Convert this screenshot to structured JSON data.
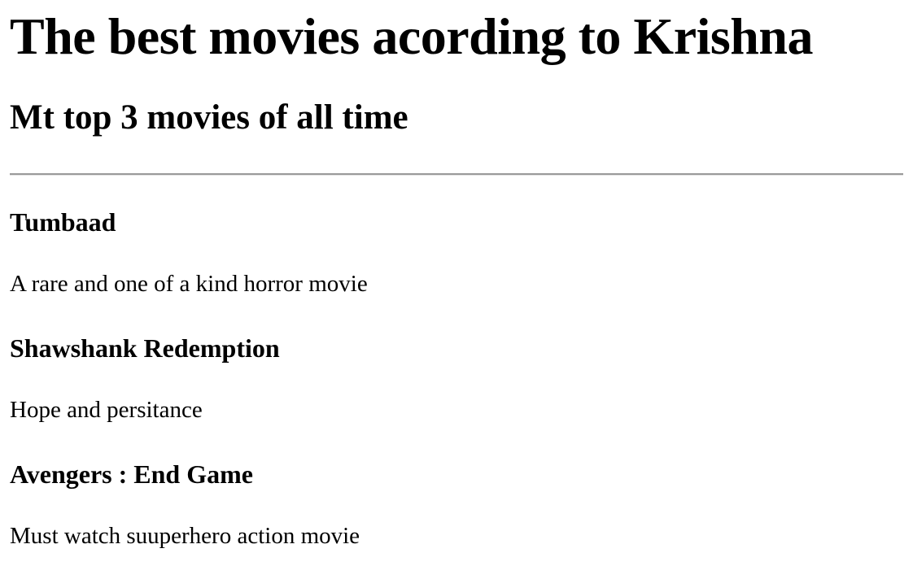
{
  "page": {
    "title": "The best movies acording to Krishna",
    "subtitle": "Mt top 3 movies of all time"
  },
  "movies": [
    {
      "title": "Tumbaad",
      "description": "A rare and one of a kind horror movie"
    },
    {
      "title": "Shawshank Redemption",
      "description": "Hope and persitance"
    },
    {
      "title": "Avengers : End Game",
      "description": "Must watch suuperhero action movie"
    }
  ]
}
